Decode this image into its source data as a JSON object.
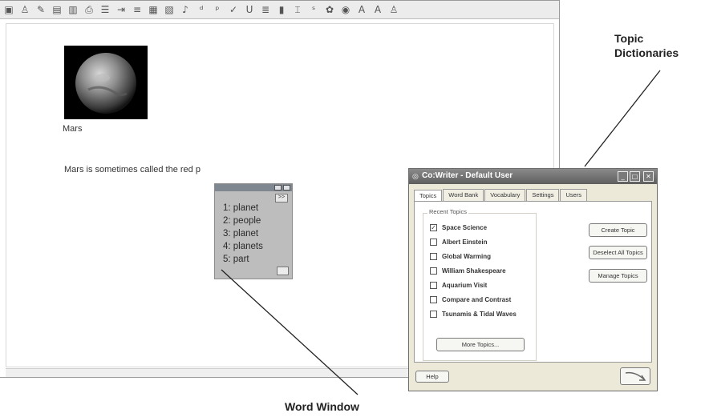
{
  "toolbar": {
    "icons": [
      "print-icon",
      "user-icon",
      "paint-icon",
      "open-icon",
      "save-icon",
      "printer-icon",
      "list-icon",
      "indent-icon",
      "align-icon",
      "grid-icon",
      "table-icon",
      "speaker-icon",
      "word-icon",
      "phrase-icon",
      "check-icon",
      "underline-icon",
      "text-icon",
      "column-icon",
      "format-icon",
      "style-icon",
      "color-icon",
      "eye-icon",
      "font-larger-icon",
      "font-smaller-icon",
      "dictionary-icon"
    ]
  },
  "document": {
    "caption": "Mars",
    "body_text": "Mars is sometimes called the red p"
  },
  "word_window": {
    "more_label": ">>",
    "predictions": [
      "1: planet",
      "2: people",
      "3: planet",
      "4: planets",
      "5: part"
    ]
  },
  "cowriter": {
    "title": "Co:Writer - Default User",
    "tabs": [
      "Topics",
      "Word Bank",
      "Vocabulary",
      "Settings",
      "Users"
    ],
    "active_tab": "Topics",
    "group_label": "Recent Topics",
    "topics": [
      {
        "label": "Space Science",
        "checked": true
      },
      {
        "label": "Albert Einstein",
        "checked": false
      },
      {
        "label": "Global Warming",
        "checked": false
      },
      {
        "label": "William Shakespeare",
        "checked": false
      },
      {
        "label": "Aquarium Visit",
        "checked": false
      },
      {
        "label": "Compare and Contrast",
        "checked": false
      },
      {
        "label": "Tsunamis & Tidal Waves",
        "checked": false
      }
    ],
    "buttons": {
      "create": "Create Topic",
      "deselect": "Deselect All Topics",
      "manage": "Manage Topics",
      "more": "More Topics...",
      "help": "Help"
    }
  },
  "callouts": {
    "topic_line1": "Topic",
    "topic_line2": "Dictionaries",
    "word_window": "Word Window"
  }
}
